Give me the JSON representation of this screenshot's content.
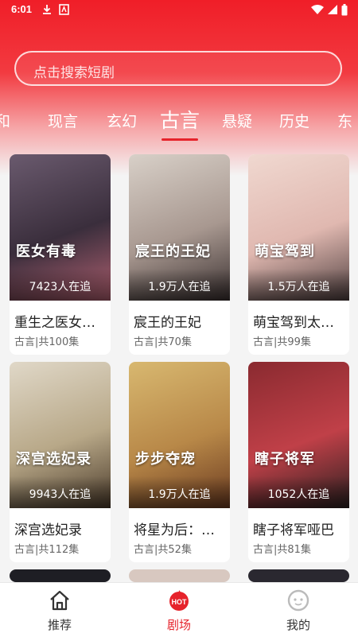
{
  "status_bar": {
    "time": "6:01"
  },
  "search": {
    "placeholder": "点击搜索短剧"
  },
  "tabs": [
    {
      "label": "和"
    },
    {
      "label": "现言"
    },
    {
      "label": "玄幻"
    },
    {
      "label": "古言",
      "active": true
    },
    {
      "label": "悬疑"
    },
    {
      "label": "历史"
    },
    {
      "label": "东"
    }
  ],
  "dramas": [
    {
      "title": "重生之医女有毒",
      "cover_text": "医女有毒",
      "followers": "7423人在追",
      "genre": "古言",
      "episodes": "共100集",
      "cover_colors": [
        "#6a5a6e",
        "#3a2e3c",
        "#b06070"
      ]
    },
    {
      "title": "宸王的王妃",
      "cover_text": "宸王的王妃",
      "followers": "1.9万人在追",
      "genre": "古言",
      "episodes": "共70集",
      "cover_colors": [
        "#d8d0c8",
        "#a89890",
        "#3a3030"
      ]
    },
    {
      "title": "萌宝驾到太子爷",
      "cover_text": "萌宝驾到",
      "followers": "1.5万人在追",
      "genre": "古言",
      "episodes": "共99集",
      "cover_colors": [
        "#f0d8d0",
        "#e0b8b0",
        "#504040"
      ]
    },
    {
      "title": "深宫选妃录",
      "cover_text": "深宫选妃录",
      "followers": "9943人在追",
      "genre": "古言",
      "episodes": "共112集",
      "cover_colors": [
        "#e0d8c8",
        "#b8a888",
        "#4a3a2a"
      ]
    },
    {
      "title": "将星为后：步步夺宠",
      "cover_text": "步步夺宠",
      "followers": "1.9万人在追",
      "genre": "古言",
      "episodes": "共52集",
      "cover_colors": [
        "#d8b870",
        "#b88848",
        "#6a3a20"
      ]
    },
    {
      "title": "瞎子将军哑巴",
      "cover_text": "瞎子将军",
      "followers": "1052人在追",
      "genre": "古言",
      "episodes": "共81集",
      "cover_colors": [
        "#8a2a30",
        "#c04048",
        "#2a2020"
      ]
    }
  ],
  "bottom_nav": [
    {
      "label": "推荐",
      "icon": "home-icon"
    },
    {
      "label": "剧场",
      "icon": "hot-icon",
      "active": true,
      "badge": "HOT"
    },
    {
      "label": "我的",
      "icon": "profile-icon"
    }
  ],
  "colors": {
    "accent": "#e6232b",
    "header_red": "#f01e28"
  }
}
